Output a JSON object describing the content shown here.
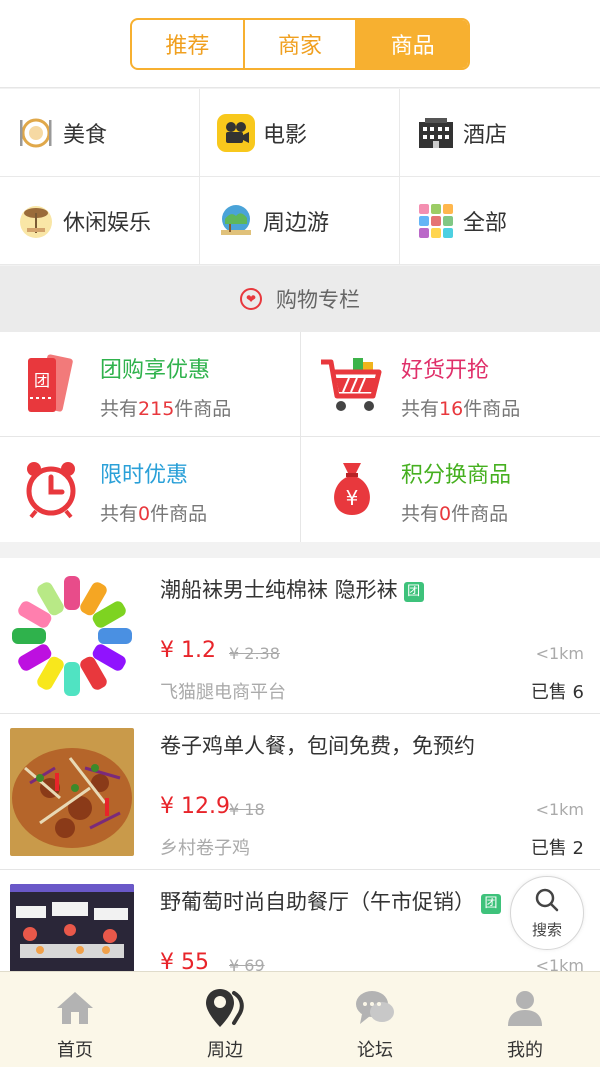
{
  "tabs": [
    {
      "label": "推荐",
      "active": false
    },
    {
      "label": "商家",
      "active": false
    },
    {
      "label": "商品",
      "active": true
    }
  ],
  "categories": [
    {
      "label": "美食",
      "icon": "food-icon"
    },
    {
      "label": "电影",
      "icon": "movie-icon"
    },
    {
      "label": "酒店",
      "icon": "hotel-icon"
    },
    {
      "label": "休闲娱乐",
      "icon": "leisure-icon"
    },
    {
      "label": "周边游",
      "icon": "travel-icon"
    },
    {
      "label": "全部",
      "icon": "all-icon"
    }
  ],
  "section": {
    "title": "购物专栏",
    "icon": "heart-icon"
  },
  "shop": [
    {
      "title": "团购享优惠",
      "pre": "共有",
      "count": "215",
      "post": "件商品",
      "icon": "ticket-icon",
      "color": "#2fb24c"
    },
    {
      "title": "好货开抢",
      "pre": "共有",
      "count": "16",
      "post": "件商品",
      "icon": "cart-icon",
      "color": "#e0306a"
    },
    {
      "title": "限时优惠",
      "pre": "共有",
      "count": "0",
      "post": "件商品",
      "icon": "alarm-clock-icon",
      "color": "#2aa0d8"
    },
    {
      "title": "积分换商品",
      "pre": "共有",
      "count": "0",
      "post": "件商品",
      "icon": "money-bag-icon",
      "color": "#46b020"
    }
  ],
  "products": [
    {
      "name": "潮船袜男士纯棉袜 隐形袜",
      "tuan": "团",
      "price": "¥ 1.2",
      "original": "¥ 2.38",
      "distance": "<1km",
      "shop": "飞猫腿电商平台",
      "sold": "已售 6"
    },
    {
      "name": "卷子鸡单人餐，包间免费，免预约",
      "tuan": "",
      "price": "¥ 12.9",
      "original": "¥ 18",
      "distance": "<1km",
      "shop": "乡村卷子鸡",
      "sold": "已售 2"
    },
    {
      "name": "野葡萄时尚自助餐厅（午市促销）",
      "tuan": "团",
      "price": "¥ 55",
      "original": "¥ 69",
      "distance": "<1km",
      "shop": "",
      "sold": ""
    }
  ],
  "float_search": {
    "label": "搜索",
    "icon": "search-icon"
  },
  "nav": [
    {
      "label": "首页",
      "icon": "home-icon"
    },
    {
      "label": "周边",
      "icon": "location-icon"
    },
    {
      "label": "论坛",
      "icon": "chat-icon"
    },
    {
      "label": "我的",
      "icon": "user-icon"
    }
  ],
  "colors": {
    "accent": "#f7b030",
    "price": "#e8242a"
  }
}
